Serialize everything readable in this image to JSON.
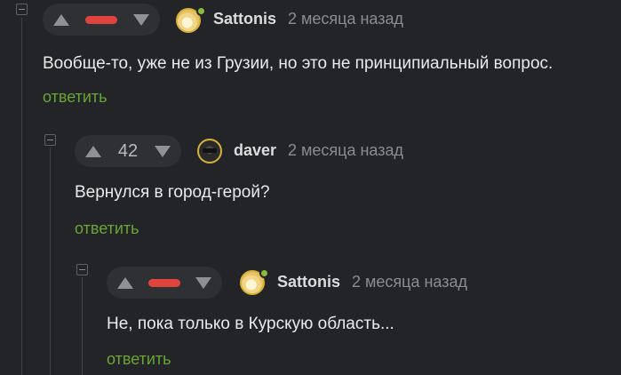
{
  "comments": [
    {
      "author": "Sattonis",
      "time": "2 месяца назад",
      "text": "Вообще-то, уже не из Грузии, но это не принципиальный вопрос.",
      "reply": "ответить",
      "rating": "negative",
      "avatar_icon": "smiling-face-avatar"
    },
    {
      "author": "daver",
      "time": "2 месяца назад",
      "score": "42",
      "text": "Вернулся в город-герой?",
      "reply": "ответить",
      "rating": "score",
      "avatar_icon": "sunglasses-avatar"
    },
    {
      "author": "Sattonis",
      "time": "2 месяца назад",
      "text": "Не, пока только в Курскую область...",
      "reply": "ответить",
      "rating": "negative",
      "avatar_icon": "smiling-face-avatar"
    }
  ],
  "colors": {
    "background": "#232427",
    "reply_link": "#6aa535",
    "negative_rating": "#e0453d",
    "online": "#8bbd3b"
  }
}
